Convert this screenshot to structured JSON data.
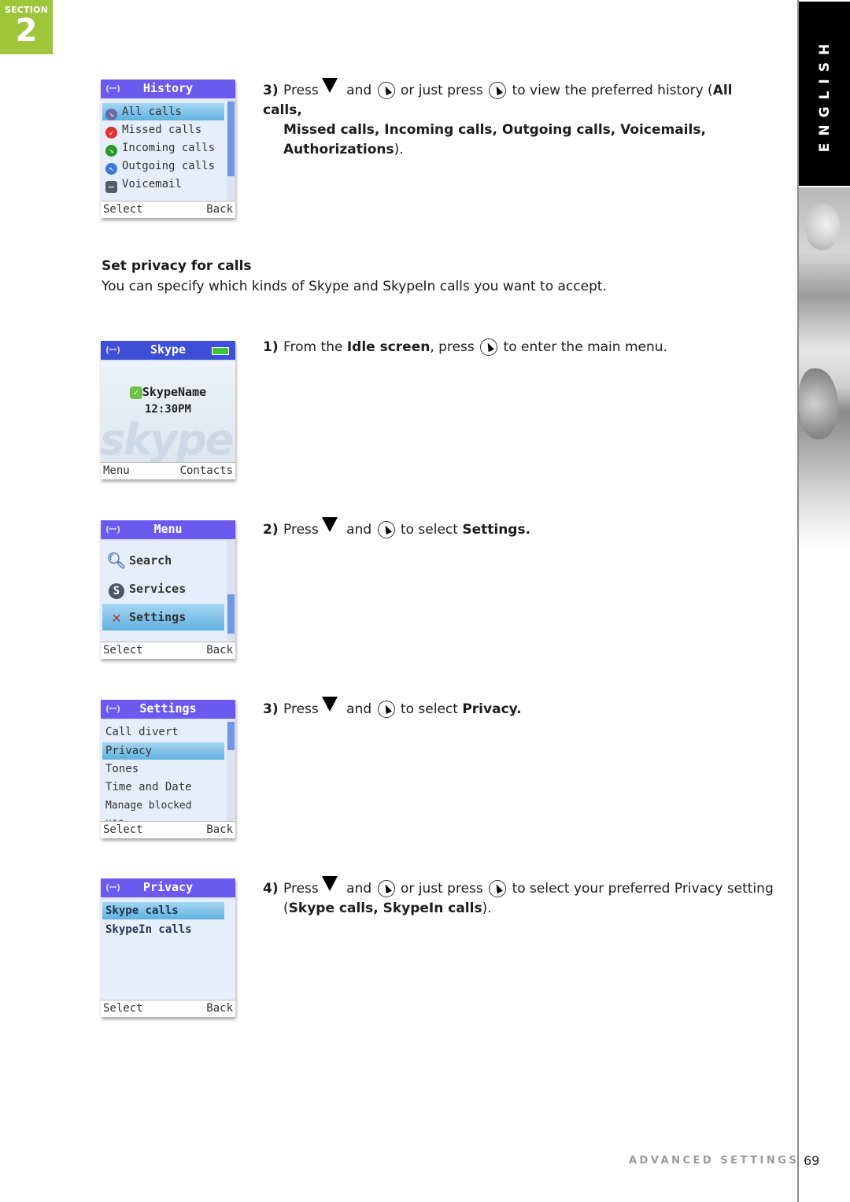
{
  "section": {
    "label": "SECTION",
    "number": "2",
    "color": "#9fc63b"
  },
  "sidebar": {
    "language": "ENGLISH"
  },
  "privacy_section": {
    "heading": "Set privacy for calls",
    "intro": "You can specify which kinds of Skype and SkypeIn calls you want to accept."
  },
  "history_step": {
    "number": "3)",
    "press": "Press",
    "and": "and",
    "or_just_press": "or just press",
    "text_after": "to view the preferred history (",
    "bold_list_1": "All calls,",
    "bold_list_2": "Missed calls, Incoming calls, Outgoing calls, Voicemails, Authorizations",
    "end": ")."
  },
  "steps": [
    {
      "number": "1)",
      "pre": "From the",
      "bold": "Idle screen",
      "mid": ", press",
      "post": "to enter the main menu."
    },
    {
      "number": "2)",
      "press": "Press",
      "and": "and",
      "post": "to select",
      "bold": "Settings."
    },
    {
      "number": "3)",
      "press": "Press",
      "and": "and",
      "post": "to select",
      "bold": "Privacy."
    },
    {
      "number": "4)",
      "press": "Press",
      "and": "and",
      "or_just_press": "or just press",
      "post": "to select your preferred Privacy setting",
      "open": "(",
      "bold": "Skype calls, SkypeIn calls",
      "end": ")."
    }
  ],
  "screens": {
    "history": {
      "title": "History",
      "items": [
        {
          "label": "All calls",
          "icon": "all-calls-icon",
          "color": "#6a6aa8",
          "selected": true
        },
        {
          "label": "Missed calls",
          "icon": "missed-calls-icon",
          "color": "#e03030"
        },
        {
          "label": "Incoming calls",
          "icon": "incoming-calls-icon",
          "color": "#2a9a2a"
        },
        {
          "label": "Outgoing calls",
          "icon": "outgoing-calls-icon",
          "color": "#3a78d8"
        },
        {
          "label": "Voicemail",
          "icon": "voicemail-icon",
          "color": "#555b66"
        }
      ],
      "left_key": "Select",
      "right_key": "Back"
    },
    "idle": {
      "title": "Skype",
      "skype_name": "SkypeName",
      "time": "12:30PM",
      "watermark": "skype",
      "left_key": "Menu",
      "right_key": "Contacts"
    },
    "menu": {
      "title": "Menu",
      "items": [
        {
          "label": "Search",
          "icon": "magnifier-icon"
        },
        {
          "label": "Services",
          "icon": "skype-s-icon"
        },
        {
          "label": "Settings",
          "icon": "tools-icon",
          "selected": true
        }
      ],
      "left_key": "Select",
      "right_key": "Back"
    },
    "settings": {
      "title": "Settings",
      "items": [
        {
          "label": "Call divert"
        },
        {
          "label": "Privacy",
          "selected": true
        },
        {
          "label": "Tones"
        },
        {
          "label": "Time and Date"
        },
        {
          "label": "Manage blocked use..."
        }
      ],
      "left_key": "Select",
      "right_key": "Back"
    },
    "privacy": {
      "title": "Privacy",
      "items": [
        {
          "label": "Skype calls",
          "selected": true
        },
        {
          "label": "SkypeIn calls"
        }
      ],
      "left_key": "Select",
      "right_key": "Back"
    }
  },
  "footer": {
    "label": "ADVANCED SETTINGS",
    "page": "69"
  }
}
